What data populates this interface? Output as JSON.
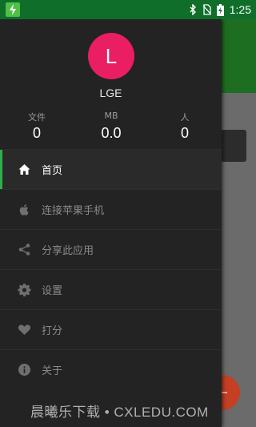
{
  "status_bar": {
    "time": "1:25",
    "icons": [
      "flash-app-icon",
      "bluetooth-icon",
      "no-sim-icon",
      "battery-charging-icon"
    ]
  },
  "drawer": {
    "avatar_letter": "L",
    "avatar_color": "#e91e63",
    "username": "LGE",
    "stats": [
      {
        "label": "文件",
        "value": "0"
      },
      {
        "label": "MB",
        "value": "0.0"
      },
      {
        "label": "人",
        "value": "0"
      }
    ],
    "menu": [
      {
        "label": "首页",
        "icon": "home-icon",
        "active": true
      },
      {
        "label": "连接苹果手机",
        "icon": "apple-icon",
        "active": false
      },
      {
        "label": "分享此应用",
        "icon": "share-icon",
        "active": false
      },
      {
        "label": "设置",
        "icon": "gear-icon",
        "active": false
      },
      {
        "label": "打分",
        "icon": "heart-icon",
        "active": false
      },
      {
        "label": "关于",
        "icon": "info-icon",
        "active": false
      }
    ],
    "accent_color": "#2fae4a"
  },
  "watermark": "晨曦乐下载 • CXLEDU.COM"
}
